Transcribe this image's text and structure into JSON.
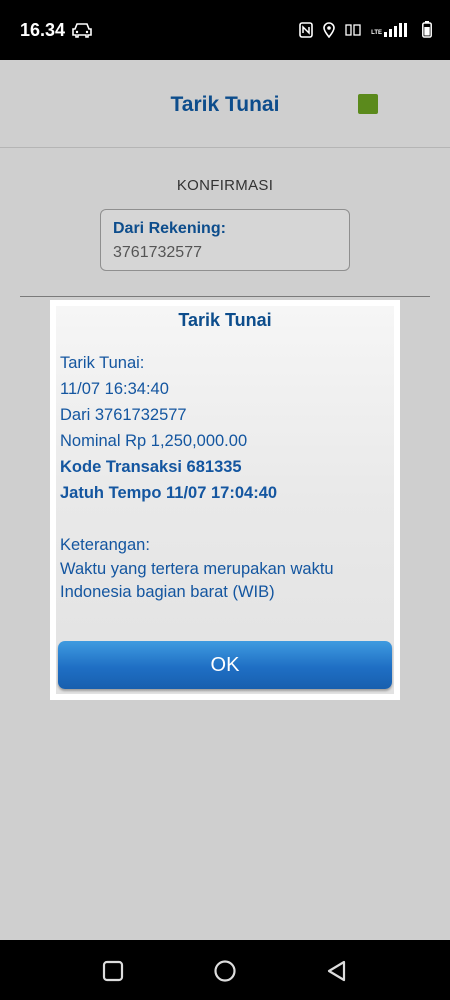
{
  "status_bar": {
    "time": "16.34",
    "icons": [
      "car-icon",
      "nfc-icon",
      "location-icon",
      "volte-icon",
      "lte-signal-icon",
      "battery-icon"
    ],
    "lte_label": "LTE"
  },
  "app": {
    "title": "Tarik Tunai",
    "indicator_color": "#5b8a1c",
    "confirm_label": "KONFIRMASI",
    "from_account_label": "Dari Rekening:",
    "from_account_value": "3761732577"
  },
  "dialog": {
    "title": "Tarik Tunai",
    "lines": [
      "Tarik Tunai:",
      "11/07 16:34:40",
      "Dari 3761732577",
      "Nominal Rp 1,250,000.00",
      "Kode Transaksi 681335",
      "Jatuh Tempo 11/07 17:04:40"
    ],
    "note_label": "Keterangan:",
    "note_text_1": "Waktu yang tertera merupakan waktu",
    "note_text_2": "Indonesia bagian barat (WIB)",
    "ok_label": "OK"
  },
  "nav_bar": {
    "buttons": [
      "recent-apps-icon",
      "home-icon",
      "back-icon"
    ]
  },
  "colors": {
    "accent": "#0d4d8c",
    "text_blue": "#1456a0",
    "button_blue": "#1f6fc4"
  }
}
